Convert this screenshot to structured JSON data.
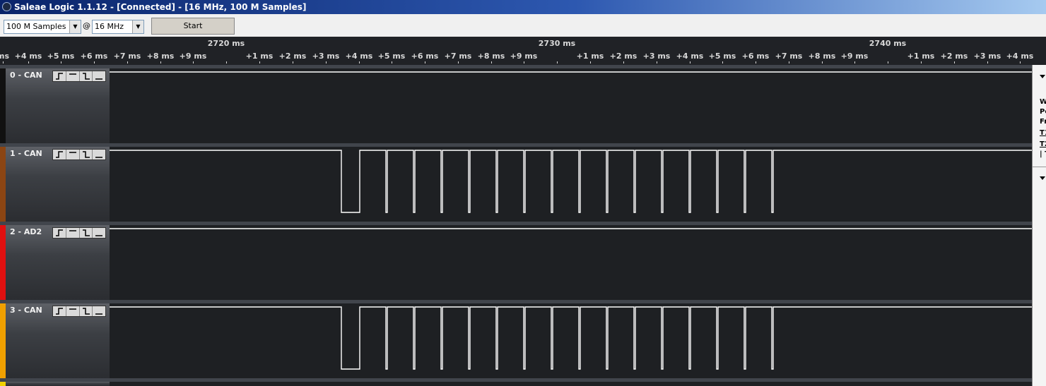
{
  "window": {
    "title": "Saleae Logic 1.1.12 - [Connected] - [16 MHz, 100 M Samples]"
  },
  "toolbar": {
    "samples_value": "100 M Samples",
    "at_sign": "@",
    "rate_value": "16 MHz",
    "start_label": "Start"
  },
  "ruler": {
    "major": [
      "2720 ms",
      "2730 ms",
      "2740 ms"
    ],
    "minor": [
      "ms",
      "+4 ms",
      "+5 ms",
      "+6 ms",
      "+7 ms",
      "+8 ms",
      "+9 ms",
      "+1 ms",
      "+2 ms",
      "+3 ms",
      "+4 ms",
      "+5 ms",
      "+6 ms",
      "+7 ms",
      "+8 ms",
      "+9 ms",
      "+1 ms",
      "+2 ms",
      "+3 ms",
      "+4 ms",
      "+5 ms",
      "+6 ms",
      "+7 ms",
      "+8 ms",
      "+9 ms",
      "+1 ms",
      "+2 ms",
      "+3 ms",
      "+4 ms"
    ]
  },
  "channels": [
    {
      "label": "0 - CAN",
      "color": "#111111"
    },
    {
      "label": "1 - CAN",
      "color": "#8b4513"
    },
    {
      "label": "2 - AD2",
      "color": "#e01010"
    },
    {
      "label": "3 - CAN",
      "color": "#f0a000"
    }
  ],
  "side_panel": {
    "lines": [
      "W",
      "Pe",
      "Fr",
      "T1",
      "T2",
      "| T"
    ]
  }
}
